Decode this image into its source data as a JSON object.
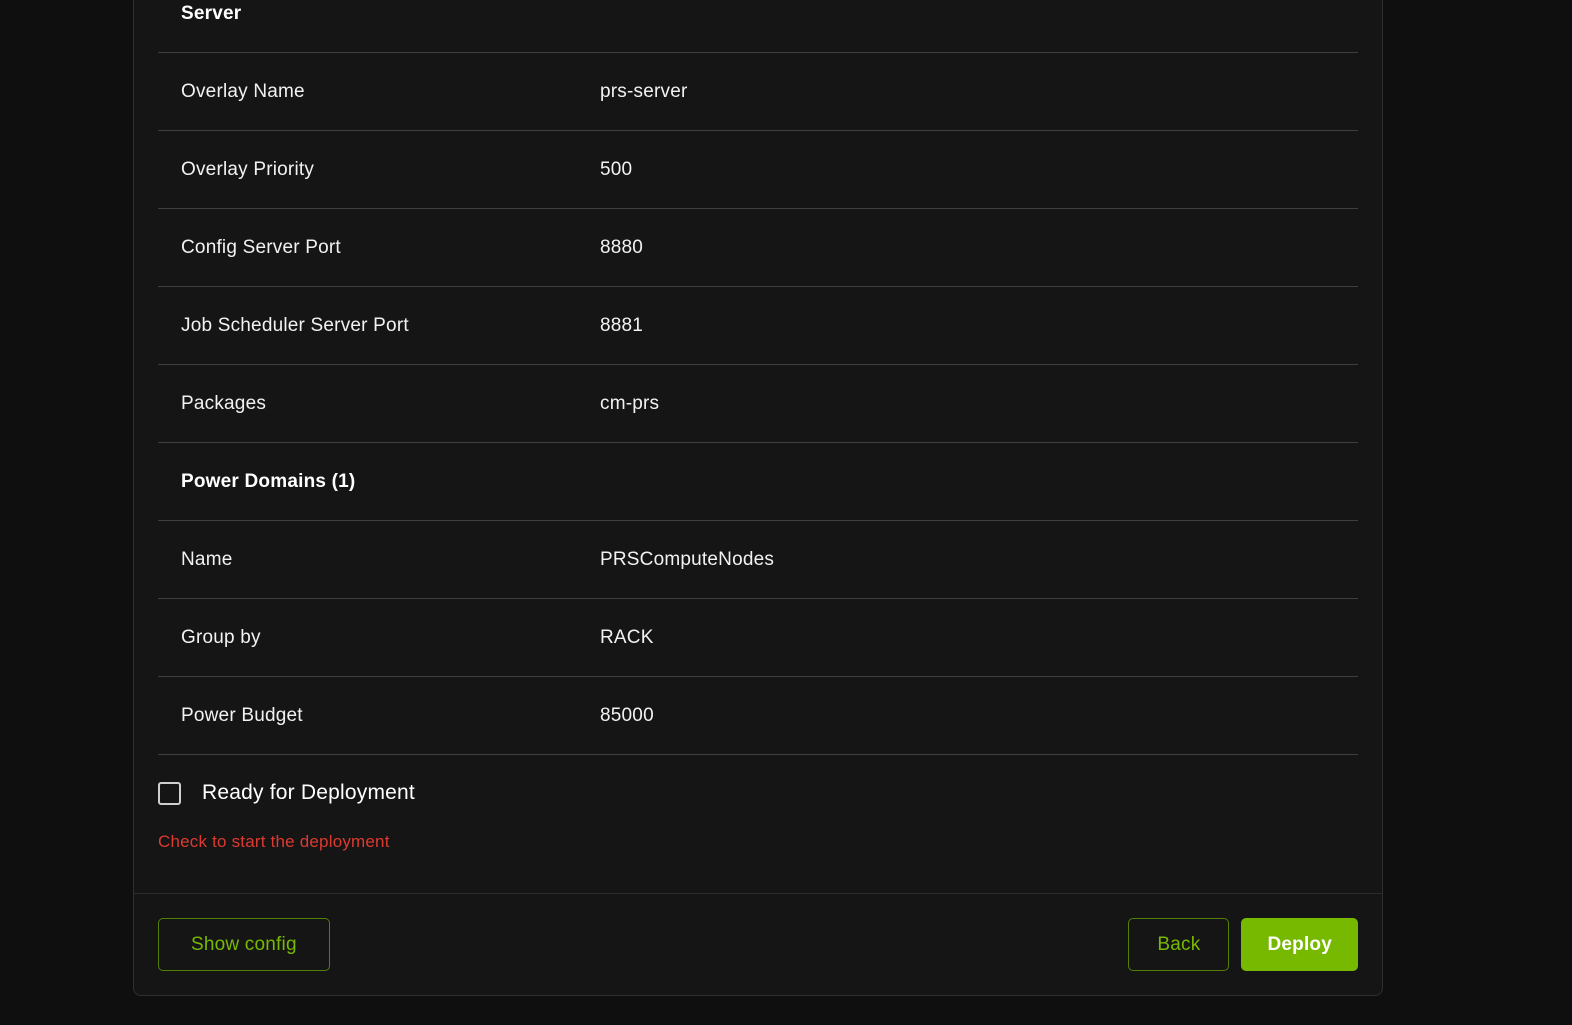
{
  "colors": {
    "accent_green": "#76b900",
    "error_red": "#dc3a30",
    "panel_bg": "#151515",
    "page_bg": "#0f0f0f"
  },
  "summary": {
    "server_section_title": "Server",
    "server_rows": [
      {
        "label": "Overlay Name",
        "value": "prs-server"
      },
      {
        "label": "Overlay Priority",
        "value": "500"
      },
      {
        "label": "Config Server Port",
        "value": "8880"
      },
      {
        "label": "Job Scheduler Server Port",
        "value": "8881"
      },
      {
        "label": "Packages",
        "value": "cm-prs"
      }
    ],
    "power_domains_section_title": "Power Domains (1)",
    "power_domain_rows": [
      {
        "label": "Name",
        "value": "PRSComputeNodes"
      },
      {
        "label": "Group by",
        "value": "RACK"
      },
      {
        "label": "Power Budget",
        "value": "85000"
      }
    ]
  },
  "deployment": {
    "checkbox_label": "Ready for Deployment",
    "checkbox_checked": false,
    "helper_text": "Check to start the deployment"
  },
  "footer": {
    "show_config_label": "Show config",
    "back_label": "Back",
    "deploy_label": "Deploy"
  }
}
